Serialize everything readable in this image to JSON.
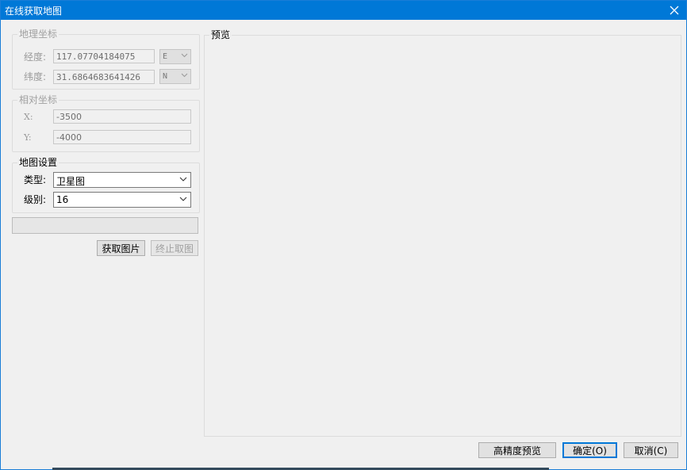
{
  "window": {
    "title": "在线获取地图"
  },
  "geo": {
    "legend": "地理坐标",
    "lon_label": "经度:",
    "lon_value": "117.07704184075",
    "lon_dir": "E",
    "lat_label": "纬度:",
    "lat_value": "31.6864683641426",
    "lat_dir": "N"
  },
  "rel": {
    "legend": "相对坐标",
    "x_label": "X:",
    "x_value": "-3500",
    "y_label": "Y:",
    "y_value": "-4000"
  },
  "map": {
    "legend": "地图设置",
    "type_label": "类型:",
    "type_value": "卫星图",
    "level_label": "级别:",
    "level_value": "16"
  },
  "actions": {
    "fetch": "获取图片",
    "stop": "终止取图"
  },
  "preview": {
    "legend": "预览"
  },
  "footer": {
    "hq_preview": "高精度预览",
    "ok": "确定(O)",
    "cancel": "取消(C)"
  },
  "progress": {
    "value": 0
  }
}
